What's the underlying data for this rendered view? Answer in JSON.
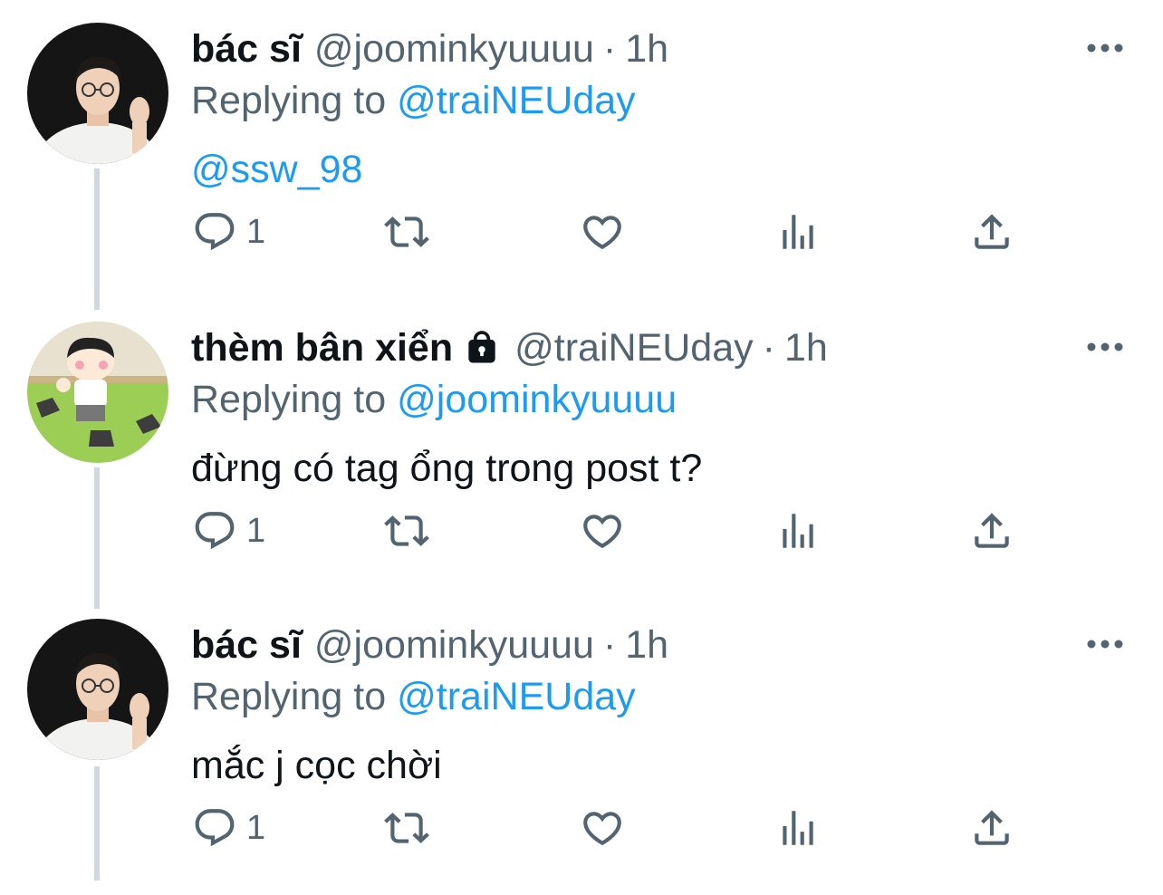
{
  "tweets": [
    {
      "display_name": "bác sĩ",
      "handle": "@joominkyuuuu",
      "separator": "·",
      "time": "1h",
      "replying_label": "Replying to",
      "replying_to": "@traiNEUday",
      "text": "@ssw_98",
      "reply_count": "1",
      "locked": false,
      "avatar": "photo-avatar"
    },
    {
      "display_name": "thèm bân xiển",
      "handle": "@traiNEUday",
      "separator": "·",
      "time": "1h",
      "replying_label": "Replying to",
      "replying_to": "@joominkyuuuu",
      "text": "đừng có tag ổng trong post t?",
      "reply_count": "1",
      "locked": true,
      "avatar": "cartoon-avatar"
    },
    {
      "display_name": "bác sĩ",
      "handle": "@joominkyuuuu",
      "separator": "·",
      "time": "1h",
      "replying_label": "Replying to",
      "replying_to": "@traiNEUday",
      "text": "mắc j cọc chời",
      "reply_count": "1",
      "locked": false,
      "avatar": "photo-avatar"
    }
  ],
  "colors": {
    "text": "#0f1419",
    "secondary": "#536471",
    "link": "#1d9bf0",
    "thread_line": "#cfd9de"
  },
  "icons": [
    "reply-icon",
    "retweet-icon",
    "like-icon",
    "views-icon",
    "share-icon",
    "more-icon",
    "lock-icon"
  ]
}
